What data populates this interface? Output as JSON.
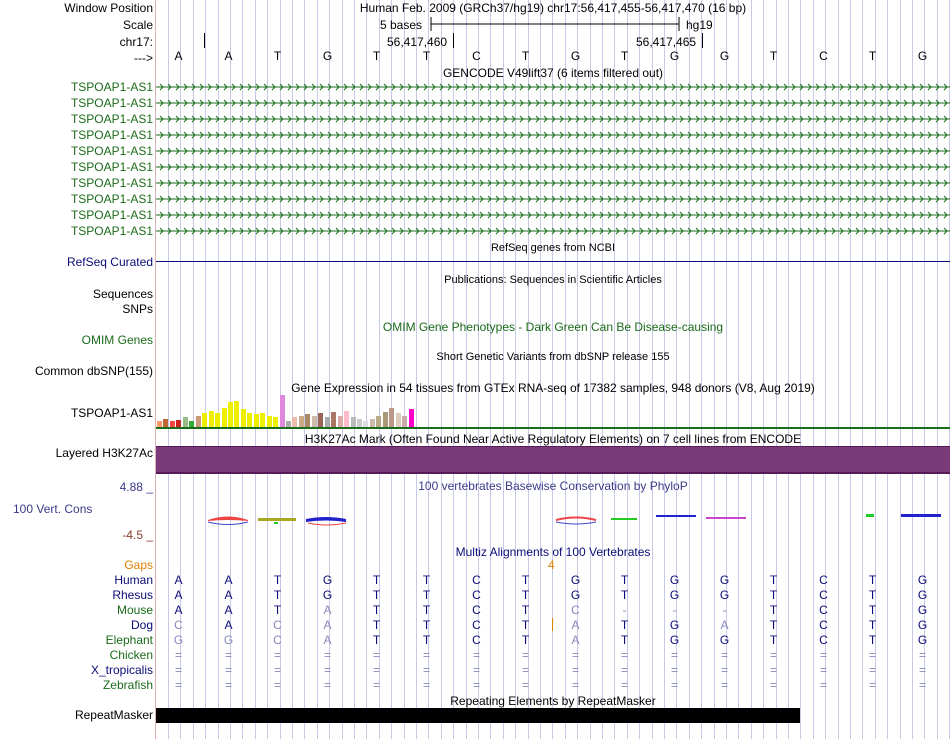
{
  "header": {
    "window_position_label": "Window Position",
    "scale_label": "Scale",
    "chrom_label": "chr17:",
    "arrow_label": "--->",
    "assembly_text": "Human Feb. 2009 (GRCh37/hg19)   chr17:56,417,455-56,417,470 (16 bp)",
    "scale_text": "5 bases",
    "db_text": "hg19",
    "pos1": "56,417,460",
    "pos2": "56,417,465"
  },
  "sequence": [
    "A",
    "A",
    "T",
    "G",
    "T",
    "T",
    "C",
    "T",
    "G",
    "T",
    "G",
    "G",
    "T",
    "C",
    "T",
    "G"
  ],
  "gencode": {
    "title": "GENCODE V49lift37 (6 items filtered out)",
    "labels": [
      "TSPOAP1-AS1",
      "TSPOAP1-AS1",
      "TSPOAP1-AS1",
      "TSPOAP1-AS1",
      "TSPOAP1-AS1",
      "TSPOAP1-AS1",
      "TSPOAP1-AS1",
      "TSPOAP1-AS1",
      "TSPOAP1-AS1",
      "TSPOAP1-AS1"
    ],
    "color": "#1a6b1a"
  },
  "refseq": {
    "title": "RefSeq genes from NCBI",
    "label": "RefSeq Curated",
    "color": "#0c0c78"
  },
  "pubs": {
    "title": "Publications: Sequences in Scientific Articles",
    "label1": "Sequences",
    "label2": "SNPs"
  },
  "omim": {
    "title": "OMIM Gene Phenotypes - Dark Green Can Be Disease-causing",
    "label": "OMIM Genes",
    "color": "#1a6b1a"
  },
  "dbsnp": {
    "title": "Short Genetic Variants from dbSNP release 155",
    "label": "Common dbSNP(155)"
  },
  "gtex": {
    "title": "Gene Expression in 54 tissues from GTEx RNA-seq of 17382 samples, 948 donors (V8, Aug 2019)",
    "label": "TSPOAP1-AS1",
    "bars": [
      {
        "v": 0.18,
        "c": "#ff9966"
      },
      {
        "v": 0.25,
        "c": "#bb6633"
      },
      {
        "v": 0.2,
        "c": "#ff4444"
      },
      {
        "v": 0.22,
        "c": "#cc2222"
      },
      {
        "v": 0.3,
        "c": "#99bb88"
      },
      {
        "v": 0.2,
        "c": "#33aa33"
      },
      {
        "v": 0.35,
        "c": "#cc9977"
      },
      {
        "v": 0.45,
        "c": "#eeee00"
      },
      {
        "v": 0.5,
        "c": "#eeee00"
      },
      {
        "v": 0.45,
        "c": "#eeee00"
      },
      {
        "v": 0.6,
        "c": "#eeee00"
      },
      {
        "v": 0.78,
        "c": "#eeee00"
      },
      {
        "v": 0.8,
        "c": "#eeee00"
      },
      {
        "v": 0.55,
        "c": "#eeee00"
      },
      {
        "v": 0.45,
        "c": "#eeee00"
      },
      {
        "v": 0.4,
        "c": "#eeee00"
      },
      {
        "v": 0.45,
        "c": "#eeee00"
      },
      {
        "v": 0.35,
        "c": "#eeee00"
      },
      {
        "v": 0.3,
        "c": "#eeee00"
      },
      {
        "v": 1.0,
        "c": "#dd88dd"
      },
      {
        "v": 0.2,
        "c": "#aaaaaa"
      },
      {
        "v": 0.3,
        "c": "#eebbaa"
      },
      {
        "v": 0.35,
        "c": "#ccaa88"
      },
      {
        "v": 0.4,
        "c": "#aa8866"
      },
      {
        "v": 0.35,
        "c": "#ccbbaa"
      },
      {
        "v": 0.45,
        "c": "#996655"
      },
      {
        "v": 0.3,
        "c": "#aaaaaa"
      },
      {
        "v": 0.48,
        "c": "#aa7766"
      },
      {
        "v": 0.35,
        "c": "#ddaaaa"
      },
      {
        "v": 0.5,
        "c": "#ffbbcc"
      },
      {
        "v": 0.3,
        "c": "#bbbbbb"
      },
      {
        "v": 0.25,
        "c": "#cccccc"
      },
      {
        "v": 0.2,
        "c": "#dddddd"
      },
      {
        "v": 0.25,
        "c": "#ccbbaa"
      },
      {
        "v": 0.35,
        "c": "#bbaa88"
      },
      {
        "v": 0.48,
        "c": "#aa9977"
      },
      {
        "v": 0.6,
        "c": "#bb9988"
      },
      {
        "v": 0.45,
        "c": "#ddccbb"
      },
      {
        "v": 0.35,
        "c": "#ccaaaa"
      },
      {
        "v": 0.55,
        "c": "#ff00cc"
      }
    ]
  },
  "h3k27": {
    "title": "H3K27Ac Mark (Often Found Near Active Regulatory Elements) on 7 cell lines from ENCODE",
    "label": "Layered H3K27Ac",
    "color": "#7b3b7b"
  },
  "cons": {
    "title": "100 vertebrates Basewise Conservation by PhyloP",
    "label": "100 Vert. Cons",
    "max": "4.88 _",
    "min": "-4.5 _",
    "color": "#3a3a8a"
  },
  "multiz": {
    "title": "Multiz Alignments of 100 Vertebrates",
    "gaps_label": "Gaps",
    "gap_value": "4",
    "species": [
      {
        "name": "Human",
        "color": "#0c0c78",
        "seq": [
          "A",
          "A",
          "T",
          "G",
          "T",
          "T",
          "C",
          "T",
          "G",
          "T",
          "G",
          "G",
          "T",
          "C",
          "T",
          "G"
        ],
        "dim": []
      },
      {
        "name": "Rhesus",
        "color": "#0c0c78",
        "seq": [
          "A",
          "A",
          "T",
          "G",
          "T",
          "T",
          "C",
          "T",
          "G",
          "T",
          "G",
          "G",
          "T",
          "C",
          "T",
          "G"
        ],
        "dim": []
      },
      {
        "name": "Mouse",
        "color": "#1a6b1a",
        "seq": [
          "A",
          "A",
          "T",
          "A",
          "T",
          "T",
          "C",
          "T",
          "C",
          "-",
          "-",
          "-",
          "T",
          "C",
          "T",
          "G"
        ],
        "dim": [
          3,
          8,
          9,
          10,
          11
        ]
      },
      {
        "name": "Dog",
        "color": "#0c0c78",
        "seq": [
          "C",
          "A",
          "C",
          "A",
          "T",
          "T",
          "C",
          "T",
          "A",
          "T",
          "G",
          "A",
          "T",
          "C",
          "T",
          "G"
        ],
        "dim": [
          0,
          2,
          3,
          8,
          11
        ]
      },
      {
        "name": "Elephant",
        "color": "#1a6b1a",
        "seq": [
          "G",
          "G",
          "C",
          "A",
          "T",
          "T",
          "C",
          "T",
          "A",
          "T",
          "G",
          "G",
          "T",
          "C",
          "T",
          "G"
        ],
        "dim": [
          0,
          1,
          2,
          3,
          8
        ]
      },
      {
        "name": "Chicken",
        "color": "#1a6b1a",
        "seq": [
          "=",
          "=",
          "=",
          "=",
          "=",
          "=",
          "=",
          "=",
          "=",
          "=",
          "=",
          "=",
          "=",
          "=",
          "=",
          "="
        ],
        "dim": "all"
      },
      {
        "name": "X_tropicalis",
        "color": "#0c0c78",
        "seq": [
          "=",
          "=",
          "=",
          "=",
          "=",
          "=",
          "=",
          "=",
          "=",
          "=",
          "=",
          "=",
          "=",
          "=",
          "=",
          "="
        ],
        "dim": "all"
      },
      {
        "name": "Zebrafish",
        "color": "#1a6b1a",
        "seq": [
          "=",
          "=",
          "=",
          "=",
          "=",
          "=",
          "=",
          "=",
          "=",
          "=",
          "=",
          "=",
          "=",
          "=",
          "=",
          "="
        ],
        "dim": "all"
      }
    ]
  },
  "repeat": {
    "title": "Repeating Elements by RepeatMasker",
    "label": "RepeatMasker"
  }
}
